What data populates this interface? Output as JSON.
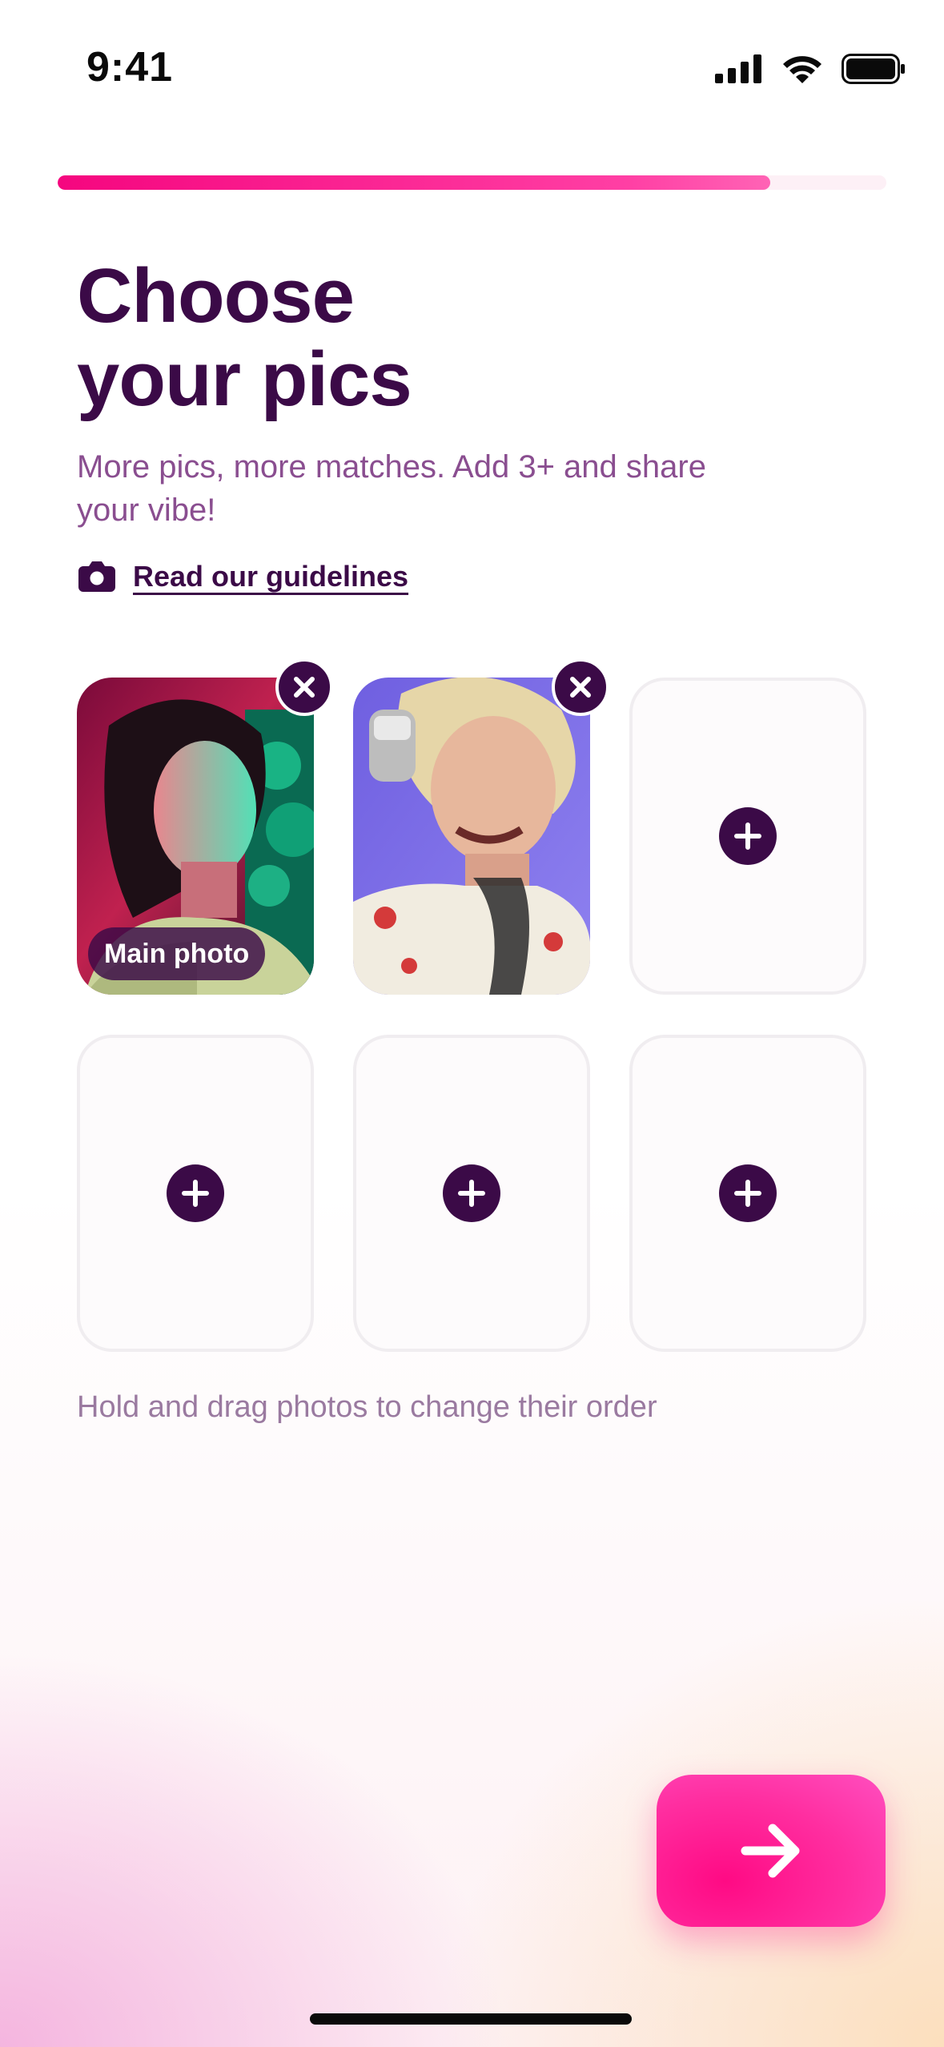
{
  "status_bar": {
    "time": "9:41"
  },
  "progress": {
    "value": 0.86,
    "color": "#f5067f"
  },
  "header": {
    "title_line1": "Choose",
    "title_line2": "your pics",
    "subtitle": "More pics, more matches. Add 3+ and share your vibe!",
    "guidelines_link": "Read our guidelines"
  },
  "photos": {
    "main_badge": "Main photo",
    "slots": [
      {
        "state": "filled",
        "is_main": true
      },
      {
        "state": "filled",
        "is_main": false
      },
      {
        "state": "empty"
      },
      {
        "state": "empty"
      },
      {
        "state": "empty"
      },
      {
        "state": "empty"
      }
    ]
  },
  "hint": "Hold and drag photos to change their order",
  "colors": {
    "primary_dark": "#3b0a47",
    "accent": "#ff0a84",
    "subtitle": "#8a4e90",
    "hint": "#9a7aa0"
  },
  "icons": {
    "guidelines": "camera-icon",
    "add": "plus-icon",
    "remove": "close-icon",
    "next": "arrow-right-icon"
  }
}
